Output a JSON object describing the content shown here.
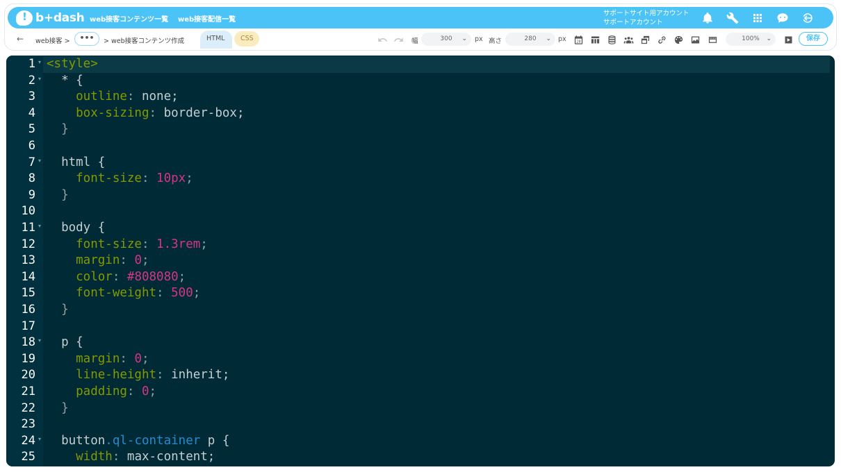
{
  "brand": {
    "logo_text": "b+dash"
  },
  "topnav": [
    {
      "label": "web接客コンテンツ一覧"
    },
    {
      "label": "web接客配信一覧"
    }
  ],
  "account": {
    "line1": "サポートサイト用アカウント",
    "line2": "サポートアカウント"
  },
  "top_icons": [
    "bell-icon",
    "wrench-icon",
    "apps-grid-icon",
    "chat-bot-icon",
    "logout-icon"
  ],
  "breadcrumb": {
    "back": "←",
    "item1": "web接客 >",
    "more": "•••",
    "item2": "> web接客コンテンツ作成"
  },
  "tabs": {
    "html": "HTML",
    "css": "CSS"
  },
  "toolbar": {
    "width_label": "幅",
    "width_value": "300",
    "width_unit": "px",
    "height_label": "高さ",
    "height_value": "280",
    "height_unit": "px",
    "calendar_day": "28",
    "zoom_value": "100%",
    "save_label": "保存",
    "icons": [
      "undo-icon",
      "redo-icon",
      "calendar-icon",
      "table-icon",
      "database-icon",
      "users-icon",
      "copy-window-icon",
      "link-icon",
      "palette-icon",
      "image-icon",
      "film-icon",
      "play-icon"
    ]
  },
  "editor": {
    "active_line": 1,
    "lines": [
      {
        "n": "1",
        "fold": true
      },
      {
        "n": "2",
        "fold": true
      },
      {
        "n": "3"
      },
      {
        "n": "4"
      },
      {
        "n": "5"
      },
      {
        "n": "6"
      },
      {
        "n": "7",
        "fold": true
      },
      {
        "n": "8"
      },
      {
        "n": "9"
      },
      {
        "n": "10"
      },
      {
        "n": "11",
        "fold": true
      },
      {
        "n": "12"
      },
      {
        "n": "13"
      },
      {
        "n": "14"
      },
      {
        "n": "15"
      },
      {
        "n": "16"
      },
      {
        "n": "17"
      },
      {
        "n": "18",
        "fold": true
      },
      {
        "n": "19"
      },
      {
        "n": "20"
      },
      {
        "n": "21"
      },
      {
        "n": "22"
      },
      {
        "n": "23"
      },
      {
        "n": "24",
        "fold": true
      },
      {
        "n": "25"
      }
    ],
    "code": [
      [
        [
          "tag",
          "<style>"
        ]
      ],
      [
        [
          "sel",
          "  * {"
        ]
      ],
      [
        [
          "prop",
          "    outline"
        ],
        [
          "punc",
          ": "
        ],
        [
          "val",
          "none;"
        ]
      ],
      [
        [
          "prop",
          "    box-sizing"
        ],
        [
          "punc",
          ": "
        ],
        [
          "val",
          "border-box;"
        ]
      ],
      [
        [
          "punc",
          "  }"
        ]
      ],
      [],
      [
        [
          "sel",
          "  html {"
        ]
      ],
      [
        [
          "prop",
          "    font-size"
        ],
        [
          "punc",
          ": "
        ],
        [
          "num",
          "10px"
        ],
        [
          "punc",
          ";"
        ]
      ],
      [
        [
          "punc",
          "  }"
        ]
      ],
      [],
      [
        [
          "sel",
          "  body {"
        ]
      ],
      [
        [
          "prop",
          "    font-size"
        ],
        [
          "punc",
          ": "
        ],
        [
          "num",
          "1.3rem"
        ],
        [
          "punc",
          ";"
        ]
      ],
      [
        [
          "prop",
          "    margin"
        ],
        [
          "punc",
          ": "
        ],
        [
          "num",
          "0"
        ],
        [
          "punc",
          ";"
        ]
      ],
      [
        [
          "prop",
          "    color"
        ],
        [
          "punc",
          ": "
        ],
        [
          "num",
          "#808080"
        ],
        [
          "punc",
          ";"
        ]
      ],
      [
        [
          "prop",
          "    font-weight"
        ],
        [
          "punc",
          ": "
        ],
        [
          "num",
          "500"
        ],
        [
          "punc",
          ";"
        ]
      ],
      [
        [
          "punc",
          "  }"
        ]
      ],
      [],
      [
        [
          "sel",
          "  p {"
        ]
      ],
      [
        [
          "prop",
          "    margin"
        ],
        [
          "punc",
          ": "
        ],
        [
          "num",
          "0"
        ],
        [
          "punc",
          ";"
        ]
      ],
      [
        [
          "prop",
          "    line-height"
        ],
        [
          "punc",
          ": "
        ],
        [
          "val",
          "inherit;"
        ]
      ],
      [
        [
          "prop",
          "    padding"
        ],
        [
          "punc",
          ": "
        ],
        [
          "num",
          "0"
        ],
        [
          "punc",
          ";"
        ]
      ],
      [
        [
          "punc",
          "  }"
        ]
      ],
      [],
      [
        [
          "sel",
          "  button"
        ],
        [
          "cls",
          ".ql-container"
        ],
        [
          "sel",
          " p {"
        ]
      ],
      [
        [
          "prop",
          "    width"
        ],
        [
          "punc",
          ": "
        ],
        [
          "val",
          "max-content;"
        ]
      ]
    ]
  },
  "colors": {
    "brand": "#4cc3f7",
    "editor_bg": "#002b36",
    "keyword": "#859900",
    "number": "#d33682",
    "class": "#268bd2"
  }
}
